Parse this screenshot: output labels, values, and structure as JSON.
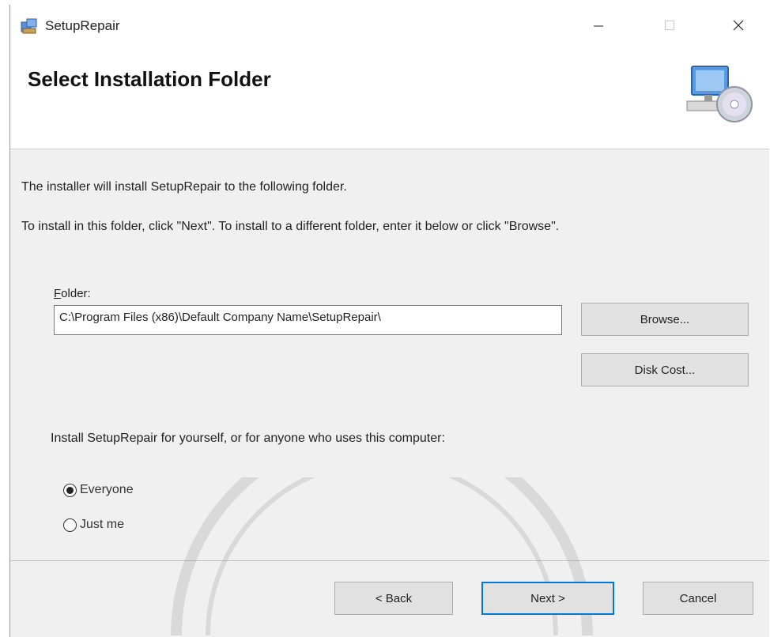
{
  "window": {
    "title": "SetupRepair",
    "icon": "installer-app-icon",
    "controls": [
      "minimize-icon",
      "maximize-icon",
      "close-icon"
    ]
  },
  "banner": {
    "title": "Select Installation Folder",
    "graphic": "computer-cd-icon"
  },
  "body": {
    "line1": "The installer will install SetupRepair to the following folder.",
    "line2": "To install in this folder, click \"Next\". To install to a different folder, enter it below or click \"Browse\".",
    "folder_label_accel": "F",
    "folder_label_rest": "older:",
    "folder_value": "C:\\Program Files (x86)\\Default Company Name\\SetupRepair\\",
    "browse_label": "Browse...",
    "disk_cost_label": "Disk Cost...",
    "scope_prompt": "Install SetupRepair for yourself, or for anyone who uses this computer:",
    "options": [
      {
        "label": "Everyone",
        "selected": true
      },
      {
        "label": "Just me",
        "selected": false
      }
    ]
  },
  "footer": {
    "back_label": "< Back",
    "next_label": "Next >",
    "cancel_label": "Cancel"
  }
}
